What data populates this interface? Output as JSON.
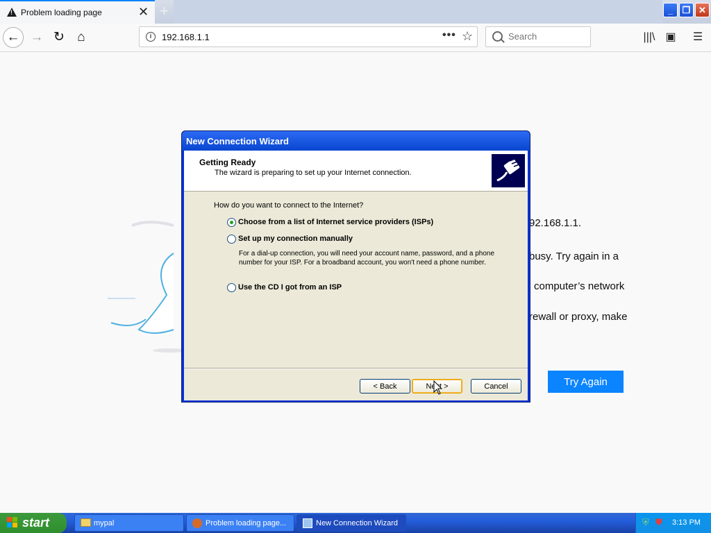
{
  "browser": {
    "tab_title": "Problem loading page",
    "url": "192.168.1.1",
    "search_placeholder": "Search",
    "page_actions": "•••",
    "star": "☆"
  },
  "error_page": {
    "fragments": [
      "92.168.1.1.",
      "busy. Try again in a",
      "computer’s network",
      "rewall or proxy, make"
    ],
    "try_again": "Try Again"
  },
  "wizard": {
    "title": "New Connection Wizard",
    "header_title": "Getting Ready",
    "header_subtitle": "The wizard is preparing to set up your Internet connection.",
    "question": "How do you want to connect to the Internet?",
    "options": [
      {
        "label": "Choose from a list of Internet service providers (ISPs)",
        "checked": true
      },
      {
        "label": "Set up my connection manually",
        "checked": false
      },
      {
        "label": "Use the CD I got from an ISP",
        "checked": false
      }
    ],
    "manual_description": "For a dial-up connection, you will need your account name, password, and a phone number for your ISP. For a broadband account, you won't need a phone number.",
    "buttons": {
      "back": "< Back",
      "next": "Next >",
      "cancel": "Cancel"
    }
  },
  "taskbar": {
    "start": "start",
    "items": [
      {
        "label": "mypal",
        "active": false
      },
      {
        "label": "Problem loading page...",
        "active": false
      },
      {
        "label": "New Connection Wizard",
        "active": true
      }
    ],
    "clock": "3:13 PM"
  }
}
